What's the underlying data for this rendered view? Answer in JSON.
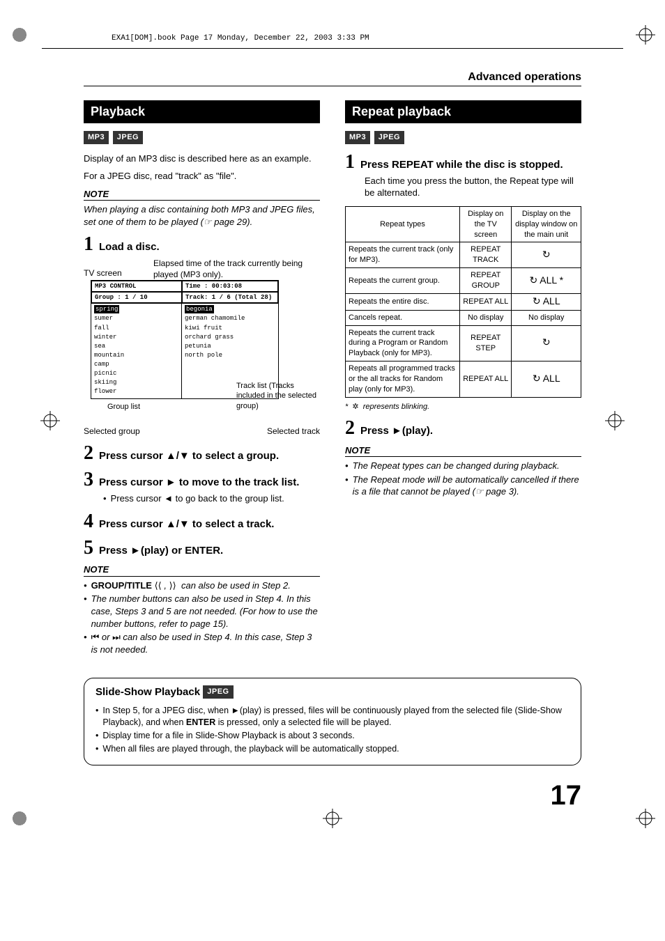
{
  "print_header": "EXA1[DOM].book  Page 17  Monday, December 22, 2003  3:33 PM",
  "section_title": "Advanced operations",
  "left": {
    "header": "Playback",
    "tags": [
      "MP3",
      "JPEG"
    ],
    "intro1": "Display of an MP3 disc is described here as an example.",
    "intro2": "For a JPEG disc, read \"track\" as \"file\".",
    "note_hdr": "NOTE",
    "note_body": "When playing a disc containing both MP3 and JPEG files, set one of them to be played (☞ page 29).",
    "step1_num": "1",
    "step1": "Load a disc.",
    "elapsed": "Elapsed time of the track currently being played (MP3 only).",
    "tv_screen": "TV screen",
    "mp3box": {
      "title": "MP3 CONTROL",
      "time": "Time : 00:03:08",
      "group_hdr": "Group : 1 / 10",
      "track_hdr": "Track:  1 / 6 (Total 28)",
      "groups": [
        "spring",
        "sumer",
        "fall",
        "winter",
        "sea",
        "mountain",
        "camp",
        "picnic",
        "skiing",
        "flower"
      ],
      "tracks": [
        "begonia",
        "german chamomile",
        "kiwi fruit",
        "orchard grass",
        "petunia",
        "north pole"
      ]
    },
    "call_grouplist": "Group list",
    "call_tracklist": "Track list (Tracks included in the selected group)",
    "sel_group": "Selected group",
    "sel_track": "Selected track",
    "step2_num": "2",
    "step2": "Press cursor ▲/▼ to select a group.",
    "step3_num": "3",
    "step3": "Press cursor ► to move to the track list.",
    "step3_sub": "Press cursor ◄ to go back to the group list.",
    "step4_num": "4",
    "step4": "Press cursor ▲/▼ to select a track.",
    "step5_num": "5",
    "step5": "Press ►(play) or ENTER.",
    "notes_hdr": "NOTE",
    "notes": [
      "GROUP/TITLE  ⦉⦉ ,  ⦊⦊  can also be used in Step 2.",
      "The number buttons can also be used in Step 4. In this case, Steps 3 and 5 are not needed. (For how to use the number buttons, refer to page 15).",
      "⏮ or ⏭ can also be used in Step 4. In this case, Step 3 is not needed."
    ]
  },
  "right": {
    "header": "Repeat playback",
    "tags": [
      "MP3",
      "JPEG"
    ],
    "step1_num": "1",
    "step1": "Press REPEAT while the disc is stopped.",
    "step1_sub": "Each time you press the button, the Repeat type will be alternated.",
    "table": {
      "h1": "Repeat types",
      "h2": "Display on the TV screen",
      "h3": "Display on the display window on the main unit",
      "rows": [
        {
          "c1": "Repeats the current track (only for MP3).",
          "c2": "REPEAT TRACK",
          "c3": "↻"
        },
        {
          "c1": "Repeats the current group.",
          "c2": "REPEAT GROUP",
          "c3": "↻ ALL *"
        },
        {
          "c1": "Repeats the entire disc.",
          "c2": "REPEAT ALL",
          "c3": "↻  ALL"
        },
        {
          "c1": "Cancels repeat.",
          "c2": "No display",
          "c3": "No display"
        },
        {
          "c1": "Repeats the current track during a Program or Random Playback (only for MP3).",
          "c2": "REPEAT STEP",
          "c3": "↻"
        },
        {
          "c1": "Repeats all programmed tracks or the all tracks for Random play (only for MP3).",
          "c2": "REPEAT ALL",
          "c3": "↻  ALL"
        }
      ]
    },
    "footnote_star": "*",
    "footnote": "represents blinking.",
    "step2_num": "2",
    "step2": "Press ►(play).",
    "notes_hdr": "NOTE",
    "notes": [
      "The Repeat types can be changed during playback.",
      "The Repeat mode will be automatically cancelled if there is a file that cannot be played (☞ page 3)."
    ]
  },
  "slide": {
    "title": "Slide-Show Playback",
    "tag": "JPEG",
    "items": [
      "In Step 5, for a JPEG disc, when ►(play) is pressed, files will be continuously played from the selected file (Slide-Show Playback), and when ENTER is pressed, only a selected file will be played.",
      "Display time for a file in Slide-Show Playback is about 3 seconds.",
      "When all files are played through, the playback will be automatically stopped."
    ],
    "enter_bold": "ENTER"
  },
  "pagenum": "17"
}
